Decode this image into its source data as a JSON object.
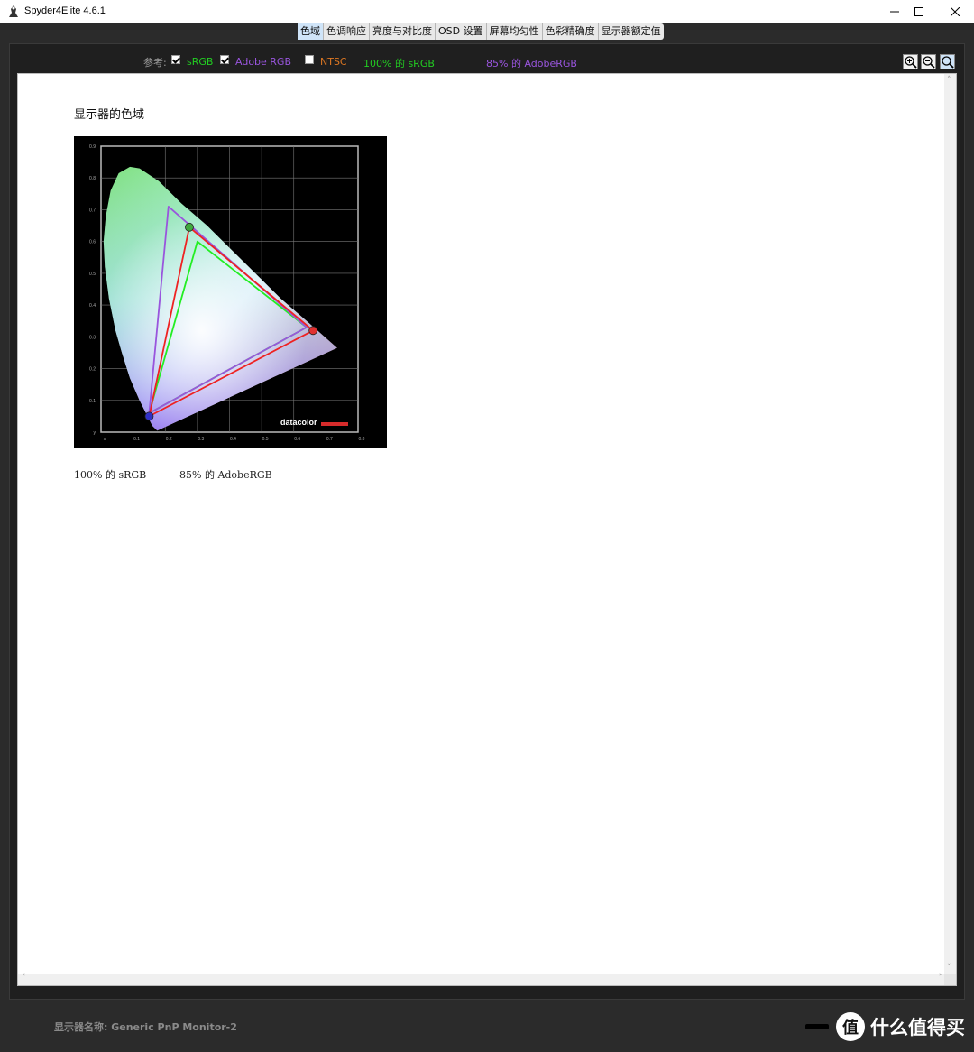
{
  "window": {
    "title": "Spyder4Elite 4.6.1"
  },
  "tabs": [
    {
      "label": "色域",
      "active": true
    },
    {
      "label": "色调响应",
      "active": false
    },
    {
      "label": "亮度与对比度",
      "active": false
    },
    {
      "label": "OSD 设置",
      "active": false
    },
    {
      "label": "屏幕均匀性",
      "active": false
    },
    {
      "label": "色彩精确度",
      "active": false
    },
    {
      "label": "显示器额定值",
      "active": false
    }
  ],
  "reference": {
    "label": "参考:",
    "items": [
      {
        "label": "sRGB",
        "checked": true,
        "color": "#22cc22"
      },
      {
        "label": "Adobe RGB",
        "checked": true,
        "color": "#9955dd"
      },
      {
        "label": "NTSC",
        "checked": false,
        "color": "#dd7722"
      }
    ],
    "summary_srgb": "100% 的 sRGB",
    "summary_adobe": "85% 的 AdobeRGB",
    "summary_srgb_color": "#22cc22",
    "summary_adobe_color": "#9955dd"
  },
  "zoom": {
    "icons": [
      "zoom-in-icon",
      "zoom-out-icon",
      "zoom-fit-icon"
    ]
  },
  "content": {
    "heading": "显示器的色域",
    "caption_srgb": "100% 的 sRGB",
    "caption_adobe": "85% 的 AdobeRGB",
    "watermark": "datacolor"
  },
  "chart_data": {
    "type": "scatter",
    "title": "",
    "x_ticks": [
      "x",
      "0.1",
      "0.2",
      "0.3",
      "0.4",
      "0.5",
      "0.6",
      "0.7",
      "0.8"
    ],
    "y_ticks": [
      "y",
      "0.1",
      "0.2",
      "0.3",
      "0.4",
      "0.5",
      "0.6",
      "0.7",
      "0.8",
      "0.9"
    ],
    "xlim": [
      0,
      0.8
    ],
    "ylim": [
      0,
      0.9
    ],
    "grid": true,
    "series": [
      {
        "points": [
          [
            0.64,
            0.33
          ],
          [
            0.3,
            0.6
          ],
          [
            0.15,
            0.06
          ]
        ],
        "color": "#22ee22"
      },
      {
        "points": [
          [
            0.64,
            0.33
          ],
          [
            0.21,
            0.71
          ],
          [
            0.15,
            0.06
          ]
        ],
        "color": "#9955dd"
      },
      {
        "points": [
          [
            0.66,
            0.32
          ],
          [
            0.275,
            0.645
          ],
          [
            0.15,
            0.05
          ]
        ],
        "color": "#ee2222"
      }
    ]
  },
  "status": {
    "monitor_label": "显示器名称: Generic PnP Monitor-2"
  },
  "brand": {
    "logo_char": "值",
    "text": "什么值得买"
  }
}
